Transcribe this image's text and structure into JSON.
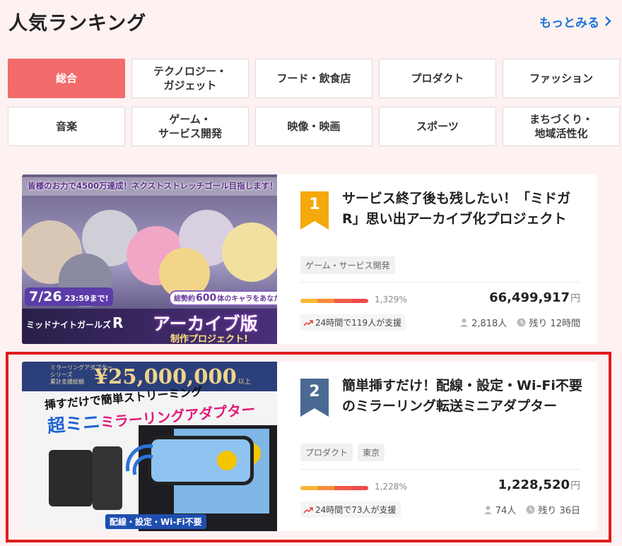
{
  "header": {
    "title": "人気ランキング",
    "more_label": "もっとみる"
  },
  "categories": [
    {
      "label": "総合",
      "active": true
    },
    {
      "label": "テクノロジー・\nガジェット",
      "active": false
    },
    {
      "label": "フード・飲食店",
      "active": false
    },
    {
      "label": "プロダクト",
      "active": false
    },
    {
      "label": "ファッション",
      "active": false
    },
    {
      "label": "音楽",
      "active": false
    },
    {
      "label": "ゲーム・\nサービス開発",
      "active": false
    },
    {
      "label": "映像・映画",
      "active": false
    },
    {
      "label": "スポーツ",
      "active": false
    },
    {
      "label": "まちづくり・\n地域活性化",
      "active": false
    }
  ],
  "projects": [
    {
      "rank": "1",
      "badge_color": "#f5a90a",
      "title": "サービス終了後も残したい！「ミドガR」思い出アーカイブ化プロジェクト",
      "tags": [
        "ゲーム・サービス開発"
      ],
      "percent": "1,329%",
      "amount": "66,499,917",
      "currency": "円",
      "support_24h": "24時間で119人が支援",
      "supporters": "2,818人",
      "remaining": "残り 12時間",
      "image": {
        "top_banner": "皆様のお力で4500万達成！ネクストストレッチゴール目指します！",
        "date": "7/26",
        "time": "23:59まで!",
        "chara_prefix": "総勢約",
        "chara_count": "600",
        "chara_suffix": "体のキャラをあなたに!",
        "logo": "ミッドナイトガールズ",
        "logo_r": "R",
        "main": "アーカイブ版",
        "sub": "制作プロジェクト!"
      }
    },
    {
      "rank": "2",
      "badge_color": "#4a6a93",
      "title": "簡単挿すだけ！配線・設定・Wi-Fi不要のミラーリング転送ミニアダプター",
      "tags": [
        "プロダクト",
        "東京"
      ],
      "percent": "1,228%",
      "amount": "1,228,520",
      "currency": "円",
      "support_24h": "24時間で73人が支援",
      "supporters": "74人",
      "remaining": "残り 36日",
      "image": {
        "series1": "ミラーリングアダプター",
        "series2": "シリーズ",
        "series3": "累計支援総額",
        "total": "¥25,000,000",
        "total_suffix": "以上",
        "line1": "挿すだけで簡単ストリーミング",
        "line2a": "超ミニ",
        "line2b": "ミラーリングアダプター",
        "footer": "配線・設定・Wi-Fi不要"
      }
    }
  ]
}
